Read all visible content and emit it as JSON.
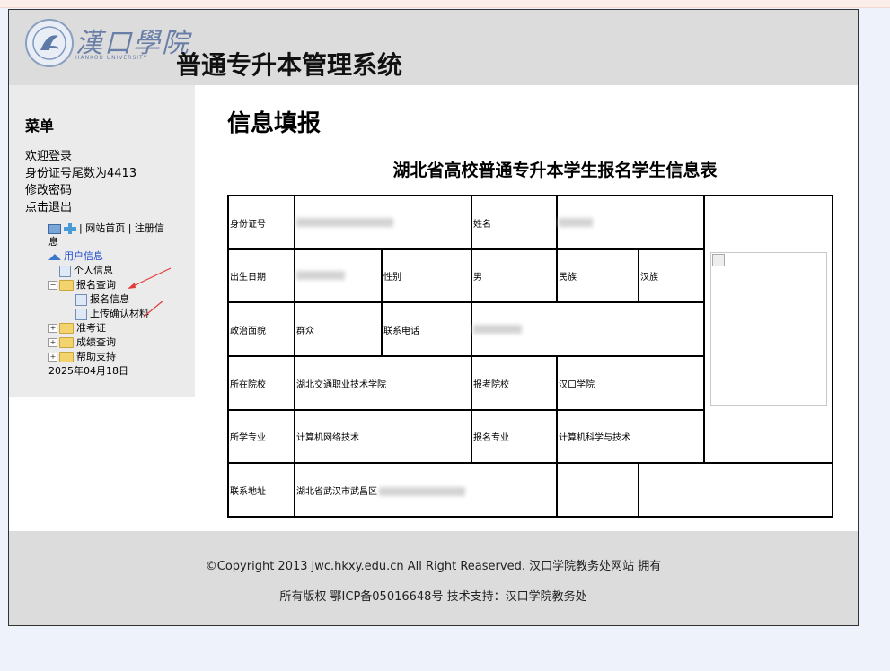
{
  "header": {
    "logo_cn": "漢口學院",
    "logo_en": "HANKOU UNIVERSITY",
    "system_title": "普通专升本管理系统"
  },
  "sidebar": {
    "menu_title": "菜单",
    "welcome": "欢迎登录",
    "id_tail": "身份证号尾数为4413",
    "change_password": "修改密码",
    "logout": "点击退出",
    "top_links": "| 网站首页 | 注册信息",
    "tree": {
      "user_info": "用户信息",
      "personal_info": "个人信息",
      "registration_query": "报名查询",
      "registration_info": "报名信息",
      "upload_materials": "上传确认材料",
      "admission_ticket": "准考证",
      "score_query": "成绩查询",
      "help": "帮助支持",
      "date": "2025年04月18日"
    }
  },
  "main": {
    "heading": "信息填报",
    "form_title": "湖北省高校普通专升本学生报名学生信息表",
    "labels": {
      "id_number": "身份证号",
      "name": "姓名",
      "birth_date": "出生日期",
      "gender": "性别",
      "ethnicity": "民族",
      "political_status": "政治面貌",
      "phone": "联系电话",
      "current_school": "所在院校",
      "apply_school": "报考院校",
      "current_major": "所学专业",
      "apply_major": "报名专业",
      "address": "联系地址"
    },
    "values": {
      "gender": "男",
      "ethnicity": "汉族",
      "political_status": "群众",
      "current_school": "湖北交通职业技术学院",
      "apply_school": "汉口学院",
      "current_major": "计算机网络技术",
      "apply_major": "计算机科学与技术",
      "address_prefix": "湖北省武汉市武昌区"
    }
  },
  "footer": {
    "line1": "©Copyright 2013 jwc.hkxy.edu.cn All Right Reaserved. 汉口学院教务处网站 拥有",
    "line2": "所有版权 鄂ICP备05016648号 技术支持：汉口学院教务处"
  }
}
